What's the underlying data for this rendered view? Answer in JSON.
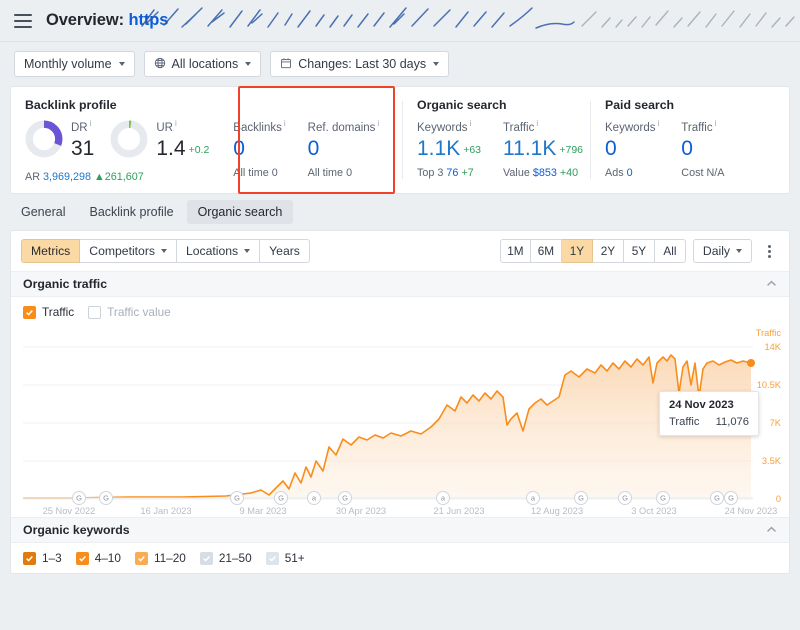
{
  "header": {
    "menu_icon": "hamburger-icon",
    "title_prefix": "Overview:",
    "title_url": "https",
    "redaction": "scribbled-out-url"
  },
  "filters": [
    {
      "label": "Monthly volume",
      "icon": "",
      "caret": true
    },
    {
      "label": "All locations",
      "icon": "globe-icon",
      "caret": true
    },
    {
      "label": "Changes: Last 30 days",
      "icon": "calendar-icon",
      "caret": true
    }
  ],
  "cards": {
    "backlink_profile": {
      "title": "Backlink profile",
      "dr": {
        "label": "DR",
        "value": "31",
        "percent": 31,
        "color": "#6c55d4"
      },
      "ur": {
        "label": "UR",
        "value": "1.4",
        "delta": "+0.2",
        "percent": 2,
        "color": "#7ec24a"
      },
      "ar": {
        "label": "AR",
        "value": "3,969,298",
        "delta": "261,607"
      },
      "backlinks": {
        "label": "Backlinks",
        "value": "0",
        "sub_label": "All time",
        "sub_value": "0"
      },
      "ref_domains": {
        "label": "Ref. domains",
        "value": "0",
        "sub_label": "All time",
        "sub_value": "0"
      }
    },
    "organic_search": {
      "title": "Organic search",
      "keywords": {
        "label": "Keywords",
        "value": "1.1K",
        "delta": "+63",
        "sub_label": "Top 3",
        "sub_value": "76",
        "sub_delta": "+7"
      },
      "traffic": {
        "label": "Traffic",
        "value": "11.1K",
        "delta": "+796",
        "sub_label": "Value",
        "sub_value": "$853",
        "sub_delta": "+40"
      }
    },
    "paid_search": {
      "title": "Paid search",
      "keywords": {
        "label": "Keywords",
        "value": "0",
        "sub_label": "Ads",
        "sub_value": "0"
      },
      "traffic": {
        "label": "Traffic",
        "value": "0",
        "sub_label": "Cost",
        "sub_value": "N/A"
      }
    },
    "highlight_color": "#f0412a"
  },
  "tabs": [
    {
      "label": "General",
      "active": false
    },
    {
      "label": "Backlink profile",
      "active": false
    },
    {
      "label": "Organic search",
      "active": true
    }
  ],
  "toolbar": {
    "segments": [
      {
        "label": "Metrics",
        "active": true,
        "caret": false
      },
      {
        "label": "Competitors",
        "active": false,
        "caret": true
      },
      {
        "label": "Locations",
        "active": false,
        "caret": true
      },
      {
        "label": "Years",
        "active": false,
        "caret": false
      }
    ],
    "ranges": [
      {
        "label": "1M",
        "active": false
      },
      {
        "label": "6M",
        "active": false
      },
      {
        "label": "1Y",
        "active": true
      },
      {
        "label": "2Y",
        "active": false
      },
      {
        "label": "5Y",
        "active": false
      },
      {
        "label": "All",
        "active": false
      }
    ],
    "granularity": {
      "label": "Daily",
      "caret": true
    },
    "more_icon": "kebab-menu-icon"
  },
  "organic_traffic": {
    "section_title": "Organic traffic",
    "collapse_icon": "chevron-up-icon",
    "legend": [
      {
        "label": "Traffic",
        "checked": true,
        "color": "#f98d1b"
      },
      {
        "label": "Traffic value",
        "checked": false,
        "color": "#ffffff"
      }
    ],
    "tooltip": {
      "date": "24 Nov 2023",
      "metric": "Traffic",
      "value": "11,076"
    }
  },
  "organic_keywords": {
    "section_title": "Organic keywords",
    "collapse_icon": "chevron-up-icon",
    "legend": [
      {
        "label": "1–3",
        "checked": true,
        "color": "#e07b0f"
      },
      {
        "label": "4–10",
        "checked": true,
        "color": "#f98d1b"
      },
      {
        "label": "11–20",
        "checked": true,
        "color": "#fbab52"
      },
      {
        "label": "21–50",
        "checked": true,
        "color": "#d6dde4"
      },
      {
        "label": "51+",
        "checked": true,
        "color": "#dde4ea"
      }
    ]
  },
  "chart_data": {
    "type": "area",
    "title": "Organic traffic",
    "xlabel": "",
    "ylabel": "Traffic",
    "ylim": [
      0,
      14000
    ],
    "yticks": [
      0,
      3500,
      7000,
      10500,
      14000
    ],
    "ytick_labels": [
      "0",
      "3.5K",
      "7K",
      "10.5K",
      "14K"
    ],
    "grid": true,
    "legend_position": "top-left",
    "line_color": "#f98d1b",
    "fill_color": "#fbe4cb",
    "xticks": [
      "25 Nov 2022",
      "16 Jan 2023",
      "9 Mar 2023",
      "30 Apr 2023",
      "21 Jun 2023",
      "12 Aug 2023",
      "3 Oct 2023",
      "24 Nov 2023"
    ],
    "last_point": {
      "date": "24 Nov 2023",
      "value": 11076
    },
    "event_markers": [
      {
        "label": "G",
        "x_pct": 7.5
      },
      {
        "label": "G",
        "x_pct": 11.5
      },
      {
        "label": "G",
        "x_pct": 30.5
      },
      {
        "label": "G",
        "x_pct": 36.5
      },
      {
        "label": "a",
        "x_pct": 41.5
      },
      {
        "label": "G",
        "x_pct": 45.5
      },
      {
        "label": "a",
        "x_pct": 59.5
      },
      {
        "label": "a",
        "x_pct": 71.0
      },
      {
        "label": "G",
        "x_pct": 77.0
      },
      {
        "label": "G",
        "x_pct": 82.5
      },
      {
        "label": "G",
        "x_pct": 88.0
      },
      {
        "label": "G",
        "x_pct": 93.5
      },
      {
        "label": "G",
        "x_pct": 95.5
      }
    ],
    "values": [
      40,
      38,
      42,
      45,
      40,
      38,
      44,
      46,
      42,
      40,
      38,
      41,
      44,
      42,
      40,
      43,
      45,
      42,
      40,
      38,
      42,
      44,
      46,
      43,
      40,
      42,
      45,
      43,
      41,
      40,
      42,
      44,
      46,
      44,
      42,
      40,
      43,
      45,
      47,
      44,
      42,
      40,
      42,
      45,
      48,
      46,
      44,
      42,
      45,
      47,
      50,
      48,
      46,
      44,
      47,
      50,
      52,
      50,
      48,
      50,
      55,
      60,
      70,
      85,
      110,
      140,
      120,
      150,
      180,
      160,
      190,
      230,
      210,
      260,
      300,
      280,
      330,
      380,
      360,
      420,
      480,
      440,
      520,
      600,
      560,
      680,
      760,
      700,
      820,
      900,
      860,
      1000,
      1150,
      1080,
      1250,
      1400,
      1320,
      1550,
      1750,
      1650,
      1900,
      2100,
      2000,
      2300,
      2600,
      2450,
      2800,
      3100,
      2950,
      3400,
      3700,
      3550,
      3900,
      4200,
      4050,
      4400,
      4300,
      4500,
      4600,
      4450,
      4700,
      4800,
      4650,
      4900,
      5000,
      4850,
      5100,
      5050,
      4950,
      5200,
      5150,
      5000,
      5300,
      5250,
      5100,
      5400,
      5350,
      5200,
      5500,
      5450,
      5300,
      5600,
      5550,
      5400,
      5700,
      5650,
      5500,
      5800,
      5750,
      5600,
      5900,
      6100,
      6400,
      6800,
      7200,
      7600,
      7400,
      7900,
      8300,
      8100,
      8500,
      8400,
      8600,
      8500,
      8700,
      8600,
      8800,
      8700,
      8900,
      8800,
      9000,
      8900,
      8700,
      8500,
      7800,
      7000,
      6400,
      6600,
      6900,
      6700,
      6300,
      5800,
      5400,
      6000,
      6600,
      7100,
      7400,
      7200,
      7600,
      7500,
      7800,
      7700,
      7900,
      7800,
      8000,
      8200,
      9800,
      10400,
      10200,
      10600,
      10400,
      10800,
      10300,
      10700,
      11000,
      10800,
      11200,
      11000,
      11400,
      11200,
      11600,
      11400,
      11000,
      11300,
      11700,
      11500,
      11800,
      11600,
      11900,
      11700,
      11400,
      10600,
      11000,
      11500,
      11900,
      12100,
      11900,
      12200,
      12000,
      12300,
      12100,
      11800,
      10200,
      11200,
      11600,
      11900,
      10800,
      10000,
      11400,
      11700,
      10300,
      11100,
      11500,
      11300,
      10900,
      11200,
      11400,
      11300,
      11100,
      11300,
      11200,
      11400,
      11300,
      11200,
      11400,
      11300,
      11500,
      11400,
      11200,
      11300,
      11400,
      11300,
      11200,
      11100,
      11200,
      11300,
      11200,
      11100,
      11076
    ]
  }
}
